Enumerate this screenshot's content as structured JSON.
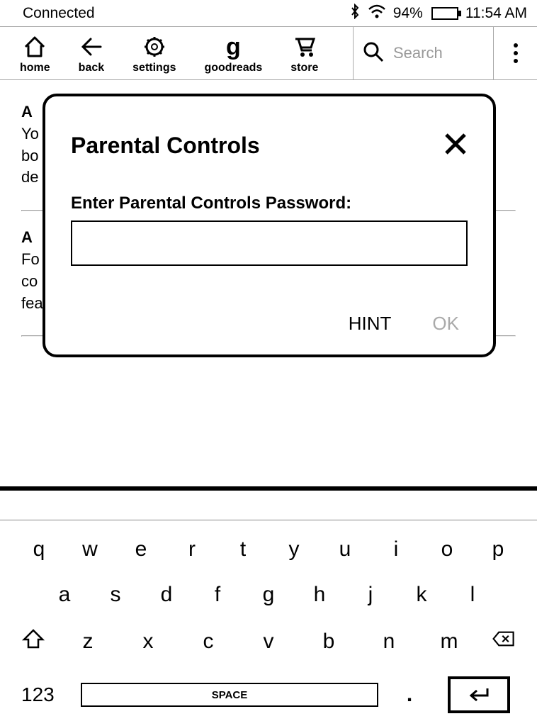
{
  "status": {
    "connection": "Connected",
    "battery_pct": "94%",
    "time": "11:54 AM"
  },
  "toolbar": {
    "home": "home",
    "back": "back",
    "settings": "settings",
    "goodreads": "goodreads",
    "store": "store",
    "search_placeholder": "Search"
  },
  "bg": {
    "s1_title": "A",
    "s1_lines": "Yo\nbo\nde",
    "s2_title": "A",
    "s2_lines": "Fo\nco\nfea"
  },
  "modal": {
    "title": "Parental Controls",
    "label": "Enter Parental Controls Password:",
    "hint": "HINT",
    "ok": "OK"
  },
  "keyboard": {
    "row1": [
      "q",
      "w",
      "e",
      "r",
      "t",
      "y",
      "u",
      "i",
      "o",
      "p"
    ],
    "row2": [
      "a",
      "s",
      "d",
      "f",
      "g",
      "h",
      "j",
      "k",
      "l"
    ],
    "row3": [
      "z",
      "x",
      "c",
      "v",
      "b",
      "n",
      "m"
    ],
    "numkey": "123",
    "space": "SPACE",
    "period": "."
  }
}
